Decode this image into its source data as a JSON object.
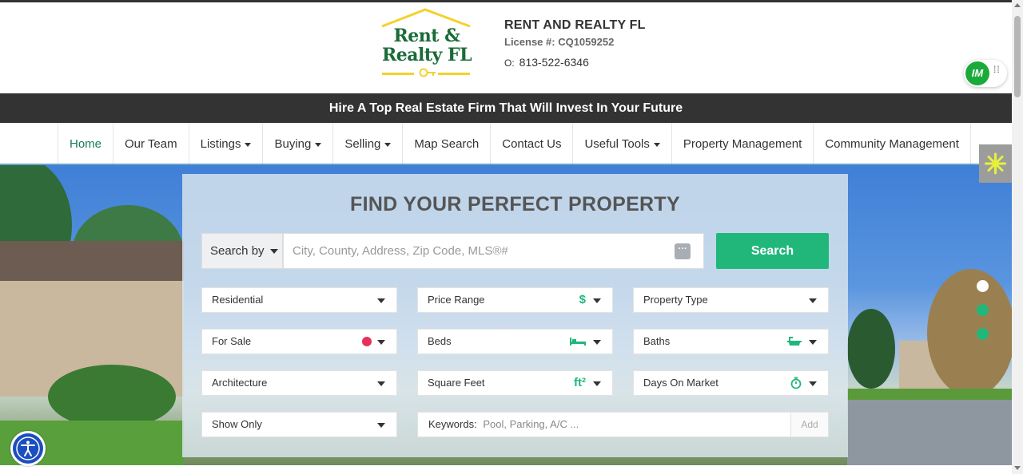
{
  "header": {
    "logo": {
      "line1": "Rent &",
      "line2": "Realty FL"
    },
    "company_name": "RENT AND REALTY FL",
    "license": "License #: CQ1059252",
    "phone_label": "O:",
    "phone": "813-522-6346",
    "badge_text": "IM"
  },
  "tagline": "Hire A Top Real Estate Firm That Will Invest In Your Future",
  "nav": {
    "items": [
      {
        "label": "Home",
        "dropdown": false,
        "active": true
      },
      {
        "label": "Our Team",
        "dropdown": false
      },
      {
        "label": "Listings",
        "dropdown": true
      },
      {
        "label": "Buying",
        "dropdown": true
      },
      {
        "label": "Selling",
        "dropdown": true
      },
      {
        "label": "Map Search",
        "dropdown": false
      },
      {
        "label": "Contact Us",
        "dropdown": false
      },
      {
        "label": "Useful Tools",
        "dropdown": true
      },
      {
        "label": "Property Management",
        "dropdown": false
      },
      {
        "label": "Community Management",
        "dropdown": false
      }
    ]
  },
  "search": {
    "title": "FIND YOUR PERFECT PROPERTY",
    "search_by": "Search by",
    "placeholder": "City, County, Address, Zip Code, MLS®#",
    "button": "Search",
    "fields": {
      "residential": "Residential",
      "price_range": "Price Range",
      "property_type": "Property Type",
      "for_sale": "For Sale",
      "beds": "Beds",
      "baths": "Baths",
      "architecture": "Architecture",
      "square_feet": "Square Feet",
      "days_on_market": "Days On Market",
      "show_only": "Show Only"
    },
    "keywords_label": "Keywords:",
    "keywords_placeholder": "Pool, Parking, A/C ...",
    "add_button": "Add"
  },
  "colors": {
    "brand_green": "#1a6b38",
    "accent_green": "#21b77b",
    "dark_bar": "#333333",
    "logo_yellow": "#f2d22e",
    "for_sale_dot": "#e53258"
  }
}
